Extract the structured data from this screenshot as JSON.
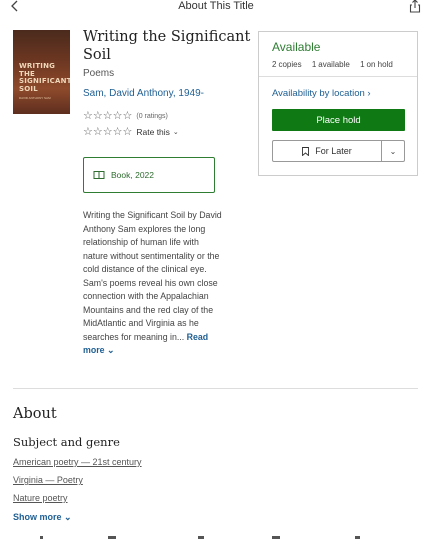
{
  "header": {
    "title": "About This Title"
  },
  "book": {
    "cover_title": "WRITING THE SIGNIFICANT SOIL",
    "cover_author": "DAVID ANTHONY SAM",
    "title": "Writing the Significant Soil",
    "genre_label": "Poems",
    "author": "Sam, David Anthony, 1949-",
    "ratings_count": "(0 ratings)",
    "rate_label": "Rate this",
    "format": "Book, 2022",
    "description": "Writing the Significant Soil by David Anthony Sam explores the long relationship of human life with nature without sentimentality or the cold distance of the clinical eye. Sam's poems reveal his own close connection with the Appalachian Mountains and the red clay of the MidAtlantic and Virginia as he searches for meaning in...",
    "read_more": "Read more"
  },
  "availability": {
    "status": "Available",
    "copies_num": "2",
    "copies_label": "copies",
    "available_num": "1",
    "available_label": "available",
    "on_hold_num": "1",
    "on_hold_label": "on hold",
    "location_link": "Availability by location",
    "place_hold": "Place hold",
    "for_later": "For Later"
  },
  "about": {
    "heading": "About",
    "subject_heading": "Subject and genre",
    "subjects": [
      "American poetry — 21st century",
      "Virginia — Poetry",
      "Nature poetry"
    ],
    "show_more": "Show more"
  },
  "colors": {
    "accent_green": "#0f7a14",
    "link_blue": "#1f5f93"
  }
}
